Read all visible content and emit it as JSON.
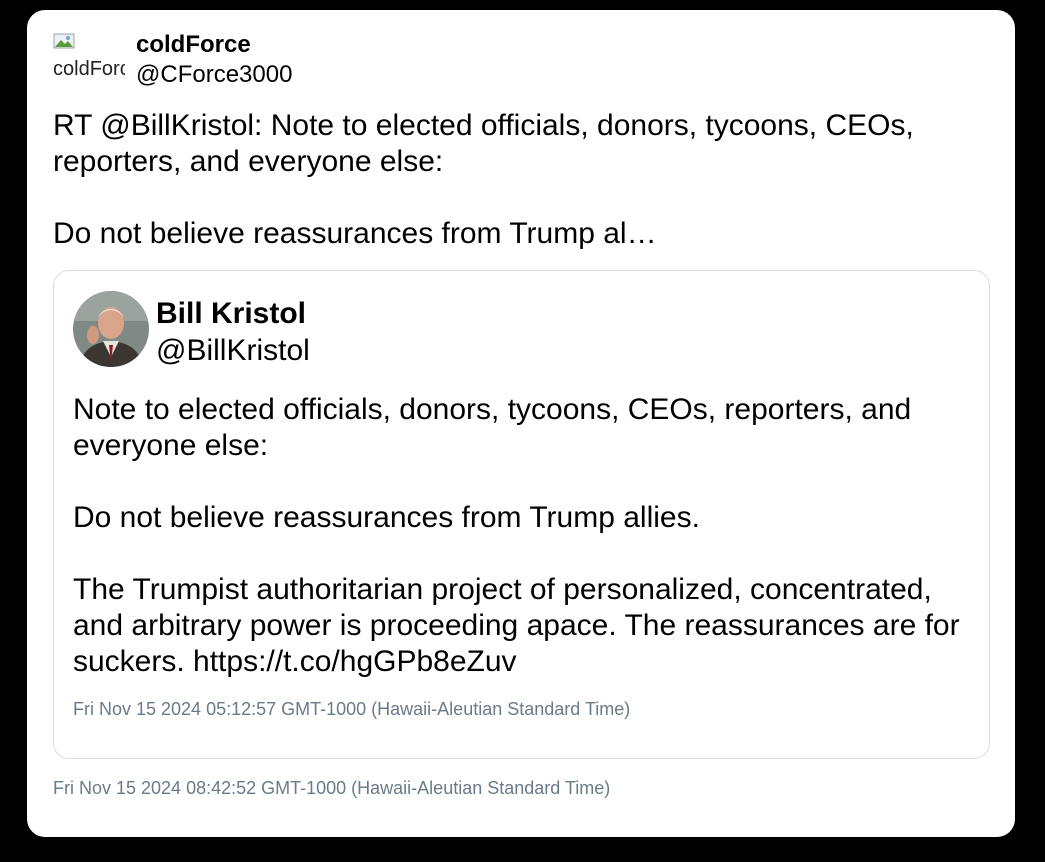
{
  "retweet": {
    "avatar_alt": "coldForce",
    "display_name": "coldForce",
    "handle": "@CForce3000",
    "text": "RT @BillKristol: Note to elected officials, donors, tycoons, CEOs, reporters, and everyone else:\n\nDo not believe reassurances from Trump al…",
    "timestamp": "Fri Nov 15 2024 08:42:52 GMT-1000 (Hawaii-Aleutian Standard Time)"
  },
  "quoted": {
    "avatar_icon": "profile-photo",
    "display_name": "Bill Kristol",
    "handle": "@BillKristol",
    "text": "Note to elected officials, donors, tycoons, CEOs, reporters, and everyone else:\n\nDo not believe reassurances from Trump allies.\n\nThe Trumpist authoritarian project of personalized, concentrated, and arbitrary power is proceeding apace. The reassurances are for suckers. https://t.co/hgGPb8eZuv",
    "timestamp": "Fri Nov 15 2024 05:12:57 GMT-1000 (Hawaii-Aleutian Standard Time)"
  },
  "colors": {
    "background": "#000000",
    "card": "#ffffff",
    "border": "#d9dee3",
    "timestamp": "#6b7a88"
  }
}
